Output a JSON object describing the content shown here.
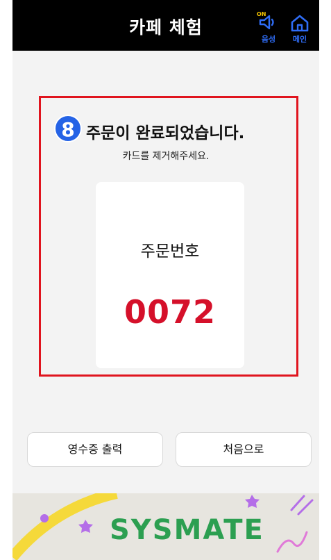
{
  "header": {
    "title": "카페 체험",
    "sound": {
      "on_badge": "ON",
      "label": "음성"
    },
    "home": {
      "label": "메인"
    }
  },
  "step": {
    "number": "8"
  },
  "message": {
    "title": "주문이 완료되었습니다.",
    "subtitle": "카드를 제거해주세요."
  },
  "order": {
    "label": "주문번호",
    "number": "0072"
  },
  "buttons": {
    "receipt": "영수증 출력",
    "restart": "처음으로"
  },
  "banner": {
    "logo_text": "SYSMATE"
  },
  "colors": {
    "header_bg": "#000000",
    "accent_blue": "#2563e6",
    "highlight_red": "#e0141e",
    "order_number_red": "#d5102a",
    "logo_green": "#2c9f51"
  }
}
